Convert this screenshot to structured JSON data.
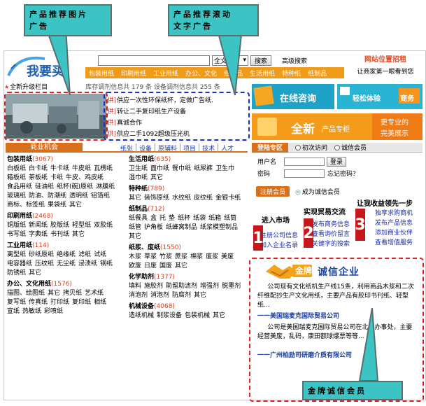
{
  "callouts": {
    "top_left": {
      "line1": "产品推荐图片",
      "line2": "广告"
    },
    "top_mid": {
      "line1": "产品推荐滚动",
      "line2": "文字广告"
    },
    "bottom": "金牌诚信会员"
  },
  "header": {
    "logo_text": "我要买",
    "search_select": "全文检",
    "search_button": "搜索",
    "advanced_search": "高级搜索",
    "slogan_line1": "网站位置招租",
    "slogan_line2": "让商家第一眼看到您",
    "nav": [
      "包装用纸",
      "印刷用纸",
      "工业用纸",
      "办公、文化",
      "纸制品",
      "生活用纸",
      "特种纸",
      "纸制品"
    ]
  },
  "status": {
    "upgrade": "全新升级栏目",
    "stats": "库存调剂信息共 179 条  设备调剂信息共 255 条"
  },
  "scroll_ads": [
    {
      "tag": "[供]",
      "text": "供应一次性环保纸杯，定做广告纸."
    },
    {
      "tag": "[供]",
      "text": "转让二手复印纸生产设备"
    },
    {
      "tag": "[供]",
      "text": "真诚合作"
    },
    {
      "tag": "[供]",
      "text": "供应二手1092超级压光机"
    }
  ],
  "ads_right": {
    "online_consult": "在线咨询",
    "easy_trial": "轻松体验",
    "business": "商务",
    "new_column": "全新",
    "new_column_sub": "产品专柜",
    "more_pro": "更专业的",
    "perfect_show": "完美展示"
  },
  "categories": {
    "title": "商业机会",
    "tabs": [
      "纸张",
      "设备",
      "原辅料",
      "项目",
      "技术",
      "人才"
    ],
    "left": [
      {
        "name": "包装用纸",
        "count": "(3067)",
        "items": [
          "白板纸",
          "白卡纸",
          "牛卡纸",
          "牛皮纸",
          "瓦楞纸",
          "箱板纸",
          "茶板纸",
          "卡纸",
          "牛皮、鸡皮纸",
          "食品用纸",
          "硅油纸",
          "纸杯(碗)原纸",
          "淋膜纸",
          "玻璃纸",
          "防油、防潮纸",
          "透明纸",
          "铝箔纸",
          "商标、标签纸",
          "果袋纸",
          "其它"
        ]
      },
      {
        "name": "印刷用纸",
        "count": "(2468)",
        "items": [
          "铜版纸",
          "新闻纸",
          "胶版纸",
          "轻型纸",
          "双胶纸",
          "书写纸",
          "字典纸",
          "书刊纸",
          "其它"
        ]
      },
      {
        "name": "工业用纸",
        "count": "(114)",
        "items": [
          "离型纸",
          "砂纸原纸",
          "绝缘纸",
          "滤纸",
          "试纸",
          "电容器纸",
          "压纹纸",
          "无尘纸",
          "浸渍纸",
          "钢纸",
          "防锈纸",
          "其它"
        ]
      },
      {
        "name": "办公、文化用纸",
        "count": "(1576)",
        "items": [
          "描图、绘图纸",
          "其它",
          "拷贝纸",
          "艺术纸",
          "复写纸",
          "传真纸",
          "打印纸",
          "复印纸",
          "相纸",
          "宣纸",
          "热敏纸",
          "彩喷纸"
        ]
      }
    ],
    "mid": [
      {
        "name": "生活用纸",
        "count": "(635)",
        "items": [
          "卫生纸",
          "面巾纸",
          "餐巾纸",
          "纸尿裤",
          "卫生巾",
          "湿巾纸",
          "其它"
        ]
      },
      {
        "name": "特种纸",
        "count": "(789)",
        "items": [
          "其它",
          "装饰原纸",
          "水纹纸",
          "皮纹纸",
          "金银卡纸"
        ]
      },
      {
        "name": "纸制品",
        "count": "(712)",
        "items": [
          "纸餐具",
          "盒",
          "托",
          "垫",
          "纸杯",
          "纸袋",
          "纸箱",
          "纸筒",
          "纸管",
          "护角板",
          "纸蜂窝制品",
          "纸浆模塑制品",
          "其它"
        ]
      },
      {
        "name": "纸浆、废纸",
        "count": "(1550)",
        "items": [
          "木浆",
          "草浆",
          "竹浆",
          "蔗浆",
          "棉浆",
          "废浆",
          "美废",
          "欧废",
          "日废",
          "国废",
          "其它"
        ]
      },
      {
        "name": "化学助剂",
        "count": "(1377)",
        "items": [
          "填料",
          "施胶剂",
          "助留助滤剂",
          "增强剂",
          "脱墨剂",
          "消泡剂",
          "消泡剂",
          "防腐剂",
          "其它"
        ]
      },
      {
        "name": "机械设备",
        "count": "(4068)",
        "items": [
          "造纸机械",
          "制浆设备",
          "包装机械",
          "其它"
        ]
      }
    ]
  },
  "login": {
    "title": "登陆专区",
    "opt1": "初次访问",
    "opt2": "诚信会员",
    "user_label": "用户名",
    "pass_label": "密码",
    "login_button": "登录",
    "forgot": "忘记密码？",
    "register": "注册会员",
    "become_member": "成为诚信会员"
  },
  "steps": {
    "step3_title": "让我收益领先一步",
    "step2_title": "实现贸易交流",
    "step1_title": "进入市场",
    "step1_lines": [
      "注册公司信息",
      "加入企业名录"
    ],
    "step2_lines": [
      "发布商务信息",
      "查看询价留言",
      "关键字的搜索"
    ],
    "step3_lines": [
      "独享求购商机",
      "发布产品信息",
      "添加商业伙伴",
      "查看增值服务"
    ],
    "num1": "1",
    "num2": "2",
    "num3": "3"
  },
  "gold": {
    "badge": "金牌",
    "title": "诚信企业",
    "text1": "公司现有文化纸机生产线15条，利用商品木浆和二次纤维配抄生产文化用纸，主要产品有胶印书刊纸、轻型纸...",
    "company1": "一一美国瑞麦克国际贸易公司",
    "text2": "公司是美国瑞麦克国际贸易公司在北京办事处，主要经营美废，乱码，康田额球爆票等等...",
    "company2": "一一广州柏励司研磨介质有限公司"
  }
}
